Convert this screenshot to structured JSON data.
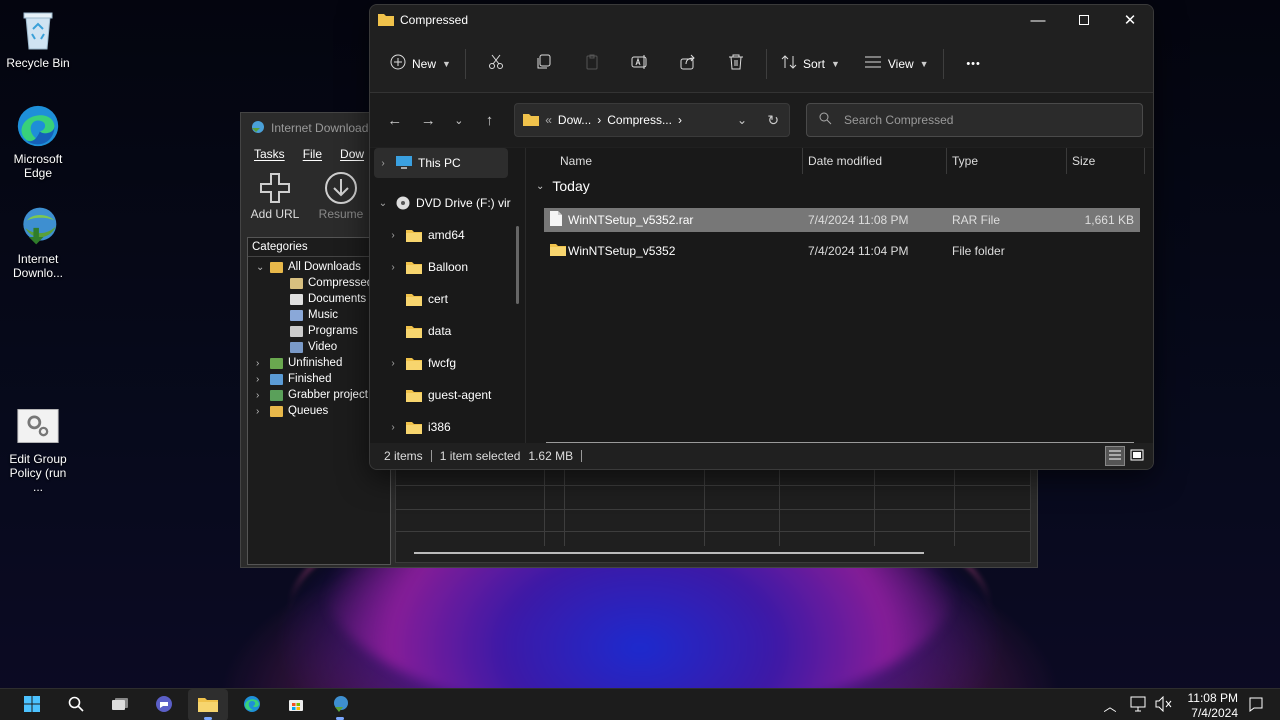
{
  "desktop": {
    "icons": [
      {
        "label": "Recycle Bin"
      },
      {
        "label": "Microsoft Edge"
      },
      {
        "label": "Internet Downlo..."
      },
      {
        "label": "Edit Group Policy (run ..."
      }
    ]
  },
  "idm": {
    "title": "Internet Download",
    "menu": [
      "Tasks",
      "File",
      "Dow"
    ],
    "toolbar": [
      {
        "label": "Add URL",
        "icon": "plus-icon"
      },
      {
        "label": "Resume",
        "icon": "download-arrow-icon"
      }
    ],
    "tree_header": "Categories",
    "tree": [
      {
        "label": "All Downloads",
        "level": 0,
        "color": "#e8b84a"
      },
      {
        "label": "Compressed",
        "level": 1,
        "color": "#d8c080"
      },
      {
        "label": "Documents",
        "level": 1,
        "color": "#e0e0e0"
      },
      {
        "label": "Music",
        "level": 1,
        "color": "#8aa8d8"
      },
      {
        "label": "Programs",
        "level": 1,
        "color": "#cccccc"
      },
      {
        "label": "Video",
        "level": 1,
        "color": "#7a9ac8"
      },
      {
        "label": "Unfinished",
        "level": 0,
        "color": "#6aa84f"
      },
      {
        "label": "Finished",
        "level": 0,
        "color": "#5b9bd5"
      },
      {
        "label": "Grabber project",
        "level": 0,
        "color": "#5aa05a"
      },
      {
        "label": "Queues",
        "level": 0,
        "color": "#e8b84a"
      }
    ]
  },
  "explorer": {
    "title": "Compressed",
    "commands": {
      "new": "New",
      "sort": "Sort",
      "view": "View",
      "more": "•••"
    },
    "address": {
      "ellipsis": "«",
      "segments": [
        "Dow...",
        "Compress..."
      ]
    },
    "search": {
      "placeholder": "Search Compressed"
    },
    "nav": [
      {
        "label": "This PC",
        "chevron": "›",
        "indent": 0
      },
      {
        "label": "DVD Drive (F:) vir",
        "chevron": "⌄",
        "indent": 0
      },
      {
        "label": "amd64",
        "chevron": "›",
        "indent": 1
      },
      {
        "label": "Balloon",
        "chevron": "›",
        "indent": 1
      },
      {
        "label": "cert",
        "chevron": "",
        "indent": 1
      },
      {
        "label": "data",
        "chevron": "",
        "indent": 1
      },
      {
        "label": "fwcfg",
        "chevron": "›",
        "indent": 1
      },
      {
        "label": "guest-agent",
        "chevron": "",
        "indent": 1
      },
      {
        "label": "i386",
        "chevron": "›",
        "indent": 1
      }
    ],
    "columns": [
      "Name",
      "Date modified",
      "Type",
      "Size"
    ],
    "group": "Today",
    "files": [
      {
        "name": "WinNTSetup_v5352.rar",
        "date": "7/4/2024 11:08 PM",
        "type": "RAR File",
        "size": "1,661 KB",
        "icon": "file-icon",
        "selected": true
      },
      {
        "name": "WinNTSetup_v5352",
        "date": "7/4/2024 11:04 PM",
        "type": "File folder",
        "size": "",
        "icon": "folder-icon",
        "selected": false
      }
    ],
    "status": {
      "count": "2 items",
      "selected": "1 item selected",
      "size": "1.62 MB"
    }
  },
  "taskbar": {
    "time": "11:08 PM",
    "date": "7/4/2024"
  },
  "colors": {
    "folder": "#f0c24b",
    "accent": "#7aa7ff",
    "selection": "#777777"
  }
}
